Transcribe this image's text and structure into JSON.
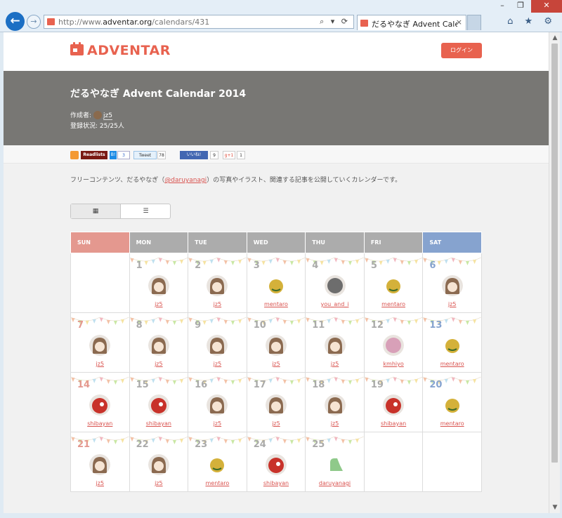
{
  "browser": {
    "url_prefix": "http://www.",
    "url_domain": "adventar.org",
    "url_path": "/calendars/431",
    "tab_title": "だるやなぎ Advent Calenda",
    "tab_close": "×",
    "addr_tools": "⌕ ▾ ⟳",
    "right_tools": "⌂ ★ ⚙",
    "min": "–",
    "restore": "❐",
    "close": "✕"
  },
  "site": {
    "logo_text": "ADVENTAR",
    "login_label": "ログイン"
  },
  "banner": {
    "title": "だるやなぎ Advent Calendar 2014",
    "creator_label": "作成者:",
    "creator_name": "jz5",
    "status": "登録状況: 25/25人"
  },
  "social": {
    "readlists": "Readlists",
    "hatena": "B!",
    "hatena_count": "3",
    "tweet": "Tweet",
    "tweet_count": "78",
    "like": "いいね!",
    "like_count": "9",
    "gplus": "g+1",
    "gplus_count": "1"
  },
  "description": {
    "before": "フリーコンテンツ、だるやなぎ（",
    "link": "@daruyanagi",
    "after": "）の写真やイラスト、関連する記事を公開していくカレンダーです。"
  },
  "toggle": {
    "calendar_icon": "▦",
    "list_icon": "☰"
  },
  "calendar": {
    "headers": [
      "SUN",
      "MON",
      "TUE",
      "WED",
      "THU",
      "FRI",
      "SAT"
    ],
    "avatar_colors": {
      "jz5": "#8b6a50",
      "mentaro": "#d4b13a",
      "you_and_i": "#6d6d6d",
      "kmhiyo": "#d8a0b8",
      "shibayan": "#c8322a",
      "daruyanagi": "#8fc98a"
    },
    "weeks": [
      [
        null,
        {
          "day": "1",
          "user": "jz5"
        },
        {
          "day": "2",
          "user": "jz5"
        },
        {
          "day": "3",
          "user": "mentaro"
        },
        {
          "day": "4",
          "user": "you_and_i"
        },
        {
          "day": "5",
          "user": "mentaro"
        },
        {
          "day": "6",
          "user": "jz5"
        }
      ],
      [
        {
          "day": "7",
          "user": "jz5"
        },
        {
          "day": "8",
          "user": "jz5"
        },
        {
          "day": "9",
          "user": "jz5"
        },
        {
          "day": "10",
          "user": "jz5"
        },
        {
          "day": "11",
          "user": "jz5"
        },
        {
          "day": "12",
          "user": "kmhiyo"
        },
        {
          "day": "13",
          "user": "mentaro"
        }
      ],
      [
        {
          "day": "14",
          "user": "shibayan"
        },
        {
          "day": "15",
          "user": "shibayan"
        },
        {
          "day": "16",
          "user": "jz5"
        },
        {
          "day": "17",
          "user": "jz5"
        },
        {
          "day": "18",
          "user": "jz5"
        },
        {
          "day": "19",
          "user": "shibayan"
        },
        {
          "day": "20",
          "user": "mentaro"
        }
      ],
      [
        {
          "day": "21",
          "user": "jz5"
        },
        {
          "day": "22",
          "user": "jz5"
        },
        {
          "day": "23",
          "user": "mentaro"
        },
        {
          "day": "24",
          "user": "shibayan"
        },
        {
          "day": "25",
          "user": "daruyanagi"
        },
        null,
        null
      ]
    ]
  }
}
